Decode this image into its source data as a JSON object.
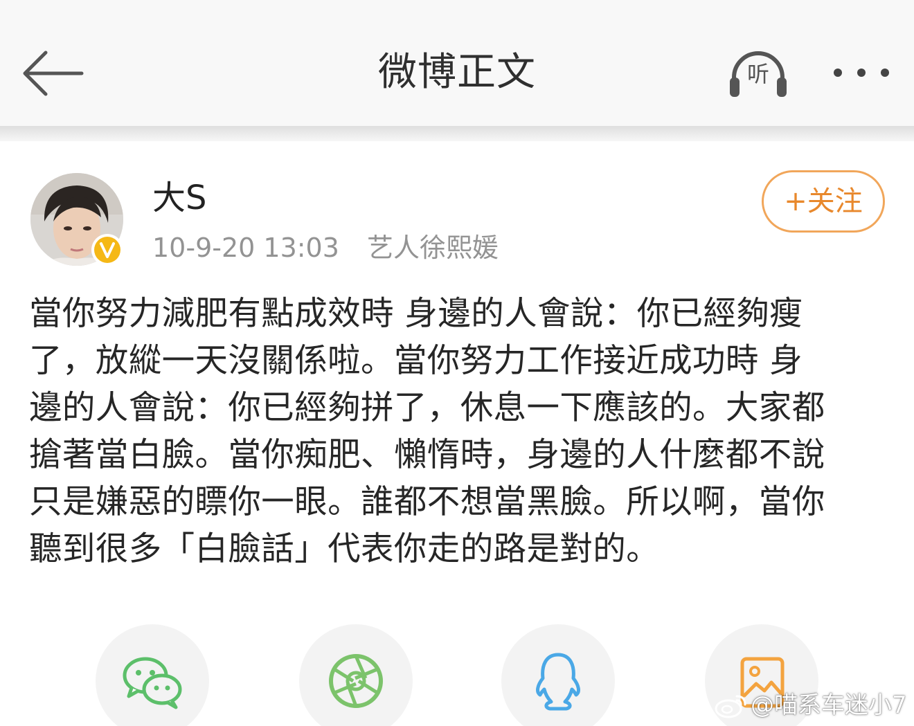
{
  "header": {
    "title": "微博正文",
    "listen_label": "听"
  },
  "post": {
    "author_name": "大S",
    "time": "10-9-20 13:03",
    "source": "艺人徐熙媛",
    "follow_label": "+关注",
    "lines": [
      "當你努力減肥有點成效時 身邊的人會說：你已經夠瘦",
      "了，放縱一天沒關係啦。當你努力工作接近成功時 身",
      "邊的人會說：你已經夠拼了，休息一下應該的。大家都",
      "搶著當白臉。當你痴肥、懶惰時，身邊的人什麼都不說",
      "只是嫌惡的瞟你一眼。誰都不想當黑臉。所以啊，當你",
      "聽到很多「白臉話」代表你走的路是對的。"
    ]
  },
  "share": {
    "items": [
      "wechat-icon",
      "moments-icon",
      "qq-icon",
      "gallery-icon"
    ]
  },
  "watermark": {
    "text": "@喵系车迷小7"
  },
  "colors": {
    "accent": "#f1a65a",
    "follow_text": "#e8882c",
    "wechat": "#5cbf6a",
    "qq": "#4aa8e6",
    "gallery": "#f3a33f",
    "meta_text": "#939393"
  }
}
